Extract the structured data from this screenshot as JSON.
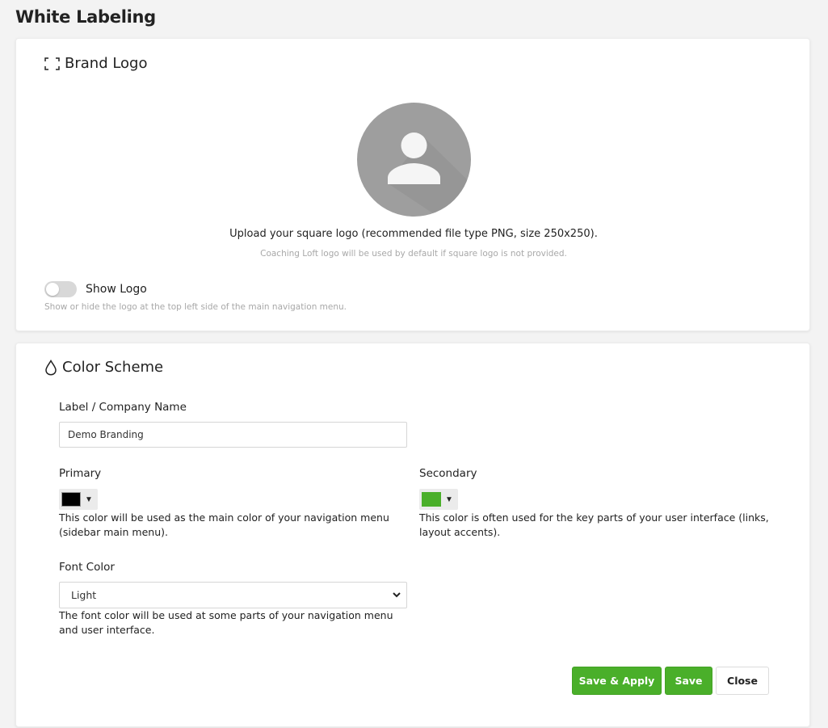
{
  "page": {
    "title": "White Labeling"
  },
  "brand_logo": {
    "title": "Brand Logo",
    "icon": "crop-frame-icon",
    "avatar_icon": "user-placeholder-icon",
    "upload_text": "Upload your square logo (recommended file type PNG, size 250x250).",
    "upload_hint": "Coaching Loft logo will be used by default if square logo is not provided.",
    "toggle": {
      "label": "Show Logo",
      "enabled": false
    },
    "toggle_hint": "Show or hide the logo at the top left side of the main navigation menu."
  },
  "color_scheme": {
    "title": "Color Scheme",
    "icon": "droplet-icon",
    "company": {
      "label": "Label / Company Name",
      "value": "Demo Branding"
    },
    "primary": {
      "label": "Primary",
      "color": "#000000",
      "description": "This color will be used as the main color of your navigation menu (sidebar main menu)."
    },
    "secondary": {
      "label": "Secondary",
      "color": "#4aaf2a",
      "description": "This color is often used for the key parts of your user interface (links, layout accents)."
    },
    "font_color": {
      "label": "Font Color",
      "selected": "Light",
      "description": "The font color will be used at some parts of your navigation menu and user interface."
    }
  },
  "actions": {
    "save_apply": "Save & Apply",
    "save": "Save",
    "close": "Close"
  },
  "colors": {
    "accent": "#4aaf2a",
    "background": "#f3f3f3",
    "card": "#ffffff"
  }
}
